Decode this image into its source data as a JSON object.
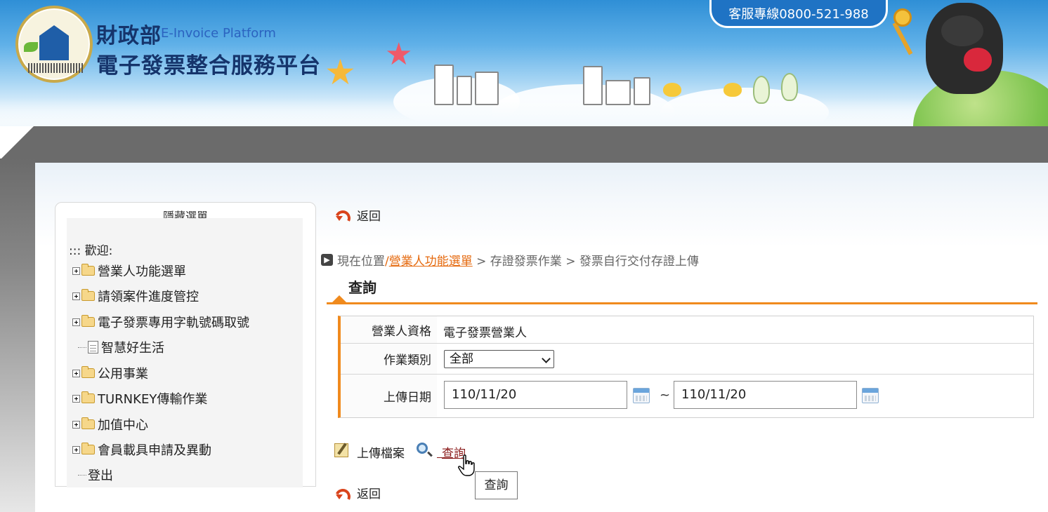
{
  "header": {
    "brand_ministry": "財政部",
    "brand_english": "E-Invoice Platform",
    "brand_platform": "電子發票整合服務平台",
    "hotline": "客服專線0800-521-988"
  },
  "sidebar": {
    "toggle_label": "隱藏選單",
    "welcome": "::: 歡迎:",
    "items": [
      {
        "label": "營業人功能選單",
        "type": "folder"
      },
      {
        "label": "請領案件進度管控",
        "type": "folder"
      },
      {
        "label": "電子發票專用字軌號碼取號",
        "type": "folder"
      },
      {
        "label": "智慧好生活",
        "type": "document"
      },
      {
        "label": "公用事業",
        "type": "folder"
      },
      {
        "label": "TURNKEY傳輸作業",
        "type": "folder"
      },
      {
        "label": "加值中心",
        "type": "folder"
      },
      {
        "label": "會員載具申請及異動",
        "type": "folder"
      },
      {
        "label": "登出",
        "type": "link"
      }
    ]
  },
  "main": {
    "back_label": "返回",
    "breadcrumb": {
      "prefix": "現在位置",
      "link": "營業人功能選單",
      "rest": " > 存證發票作業 > 發票自行交付存證上傳"
    },
    "section_title": "查詢",
    "form": {
      "qualification_label": "營業人資格",
      "qualification_value": "電子發票營業人",
      "category_label": "作業類別",
      "category_selected": "全部",
      "upload_date_label": "上傳日期",
      "date_from": "110/11/20",
      "date_separator": "~",
      "date_to": "110/11/20"
    },
    "actions": {
      "upload_label": "上傳檔案",
      "query_label": "查詢"
    },
    "tooltip": "查詢"
  },
  "colors": {
    "accent_orange": "#f08a1d",
    "brand_navy": "#15346b",
    "link_red": "#8a1a1a",
    "breadcrumb_link": "#e56a0f"
  }
}
